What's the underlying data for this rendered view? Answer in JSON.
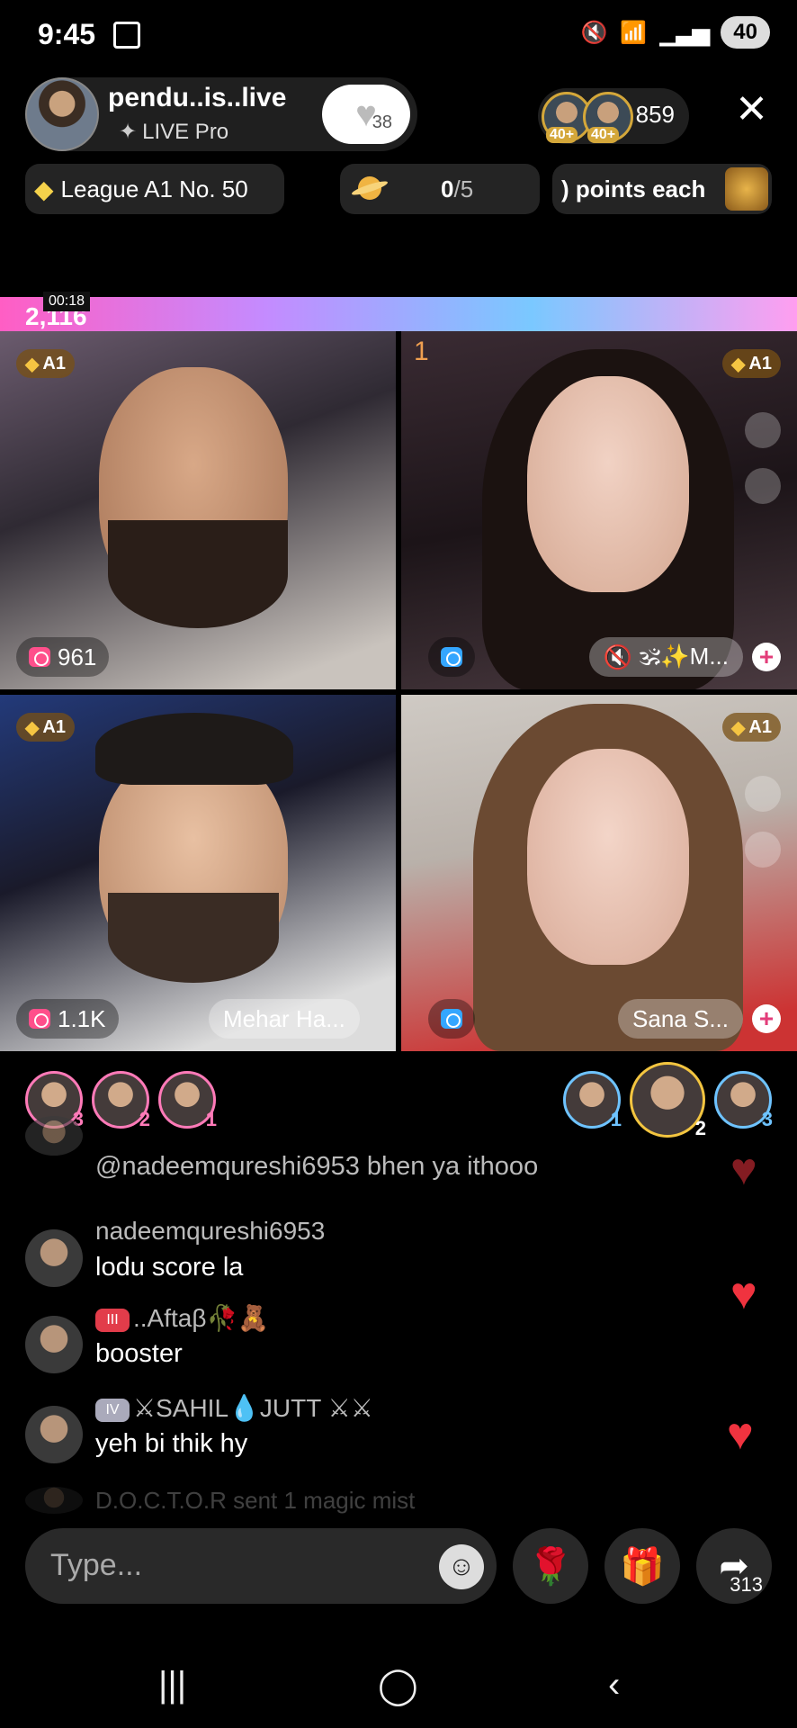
{
  "status": {
    "time": "9:45",
    "battery": "40"
  },
  "host": {
    "name": "pendu..is..live",
    "subtitle": "LIVE Pro",
    "follow_count": "38"
  },
  "viewers": {
    "count": "859",
    "badge1": "40+",
    "badge2": "40+"
  },
  "pills": {
    "league": "League A1 No. 50",
    "progress_value": "0",
    "progress_total": "/5",
    "points": ") points each"
  },
  "battle": {
    "timer": "00:18",
    "score": "2,116",
    "rank": "1"
  },
  "tiles": [
    {
      "league": "A1",
      "score": "961",
      "name": ""
    },
    {
      "league": "A1",
      "score": "",
      "name": "🕉✨M..."
    },
    {
      "league": "A1",
      "score": "1.1K",
      "name": "Mehar Ha..."
    },
    {
      "league": "A1",
      "score": "",
      "name": "Sana S..."
    }
  ],
  "gifters_left": [
    "3",
    "2",
    "1"
  ],
  "gifters_right": [
    "1",
    "2",
    "3"
  ],
  "chat": [
    {
      "user": "",
      "text": "@nadeemqureshi6953 bhen ya ithooo"
    },
    {
      "user": "nadeemqureshi6953",
      "text": "lodu score la"
    },
    {
      "user": "..Aftaβ🥀🧸",
      "text": "booster",
      "badge": "III"
    },
    {
      "user": "⚔SAHIL💧JUTT ⚔⚔",
      "text": "yeh bi thik hy",
      "badge": "IV"
    },
    {
      "user": "",
      "text": "D.O.C.T.O.R sent 1 magic mist"
    }
  ],
  "input": {
    "placeholder": "Type..."
  },
  "share_count": "313",
  "icons": {
    "close": "close-icon",
    "gift": "gift-icon",
    "rose": "rose-icon",
    "share": "share-icon",
    "emoji": "emoji-icon",
    "heart": "heart-icon"
  }
}
